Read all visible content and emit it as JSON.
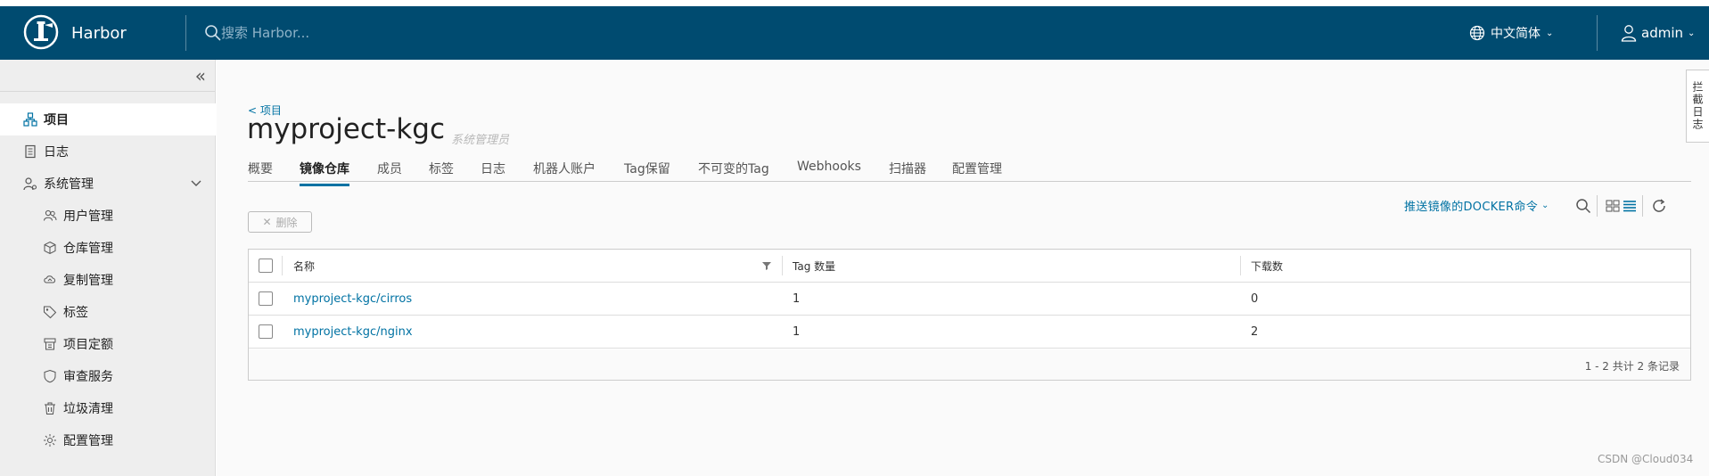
{
  "header": {
    "brand": "Harbor",
    "search_placeholder": "搜索 Harbor...",
    "language": "中文简体",
    "user": "admin"
  },
  "sidebar": {
    "items": [
      {
        "label": "项目",
        "icon": "projects-icon",
        "active": true
      },
      {
        "label": "日志",
        "icon": "logs-icon"
      },
      {
        "label": "系统管理",
        "icon": "admin-icon",
        "expanded": true
      }
    ],
    "sub_items": [
      {
        "label": "用户管理",
        "icon": "users-icon"
      },
      {
        "label": "仓库管理",
        "icon": "registries-icon"
      },
      {
        "label": "复制管理",
        "icon": "replication-icon"
      },
      {
        "label": "标签",
        "icon": "tag-icon"
      },
      {
        "label": "项目定额",
        "icon": "quota-icon"
      },
      {
        "label": "审查服务",
        "icon": "shield-icon"
      },
      {
        "label": "垃圾清理",
        "icon": "trash-icon"
      },
      {
        "label": "配置管理",
        "icon": "gear-icon"
      }
    ]
  },
  "project": {
    "back_link": "< 项目",
    "title": "myproject-kgc",
    "role": "系统管理员"
  },
  "tabs": [
    {
      "label": "概要"
    },
    {
      "label": "镜像仓库",
      "active": true
    },
    {
      "label": "成员"
    },
    {
      "label": "标签"
    },
    {
      "label": "日志"
    },
    {
      "label": "机器人账户"
    },
    {
      "label": "Tag保留"
    },
    {
      "label": "不可变的Tag"
    },
    {
      "label": "Webhooks"
    },
    {
      "label": "扫描器"
    },
    {
      "label": "配置管理"
    }
  ],
  "toolbar": {
    "delete_label": "删除",
    "push_command": "推送镜像的DOCKER命令"
  },
  "table": {
    "columns": [
      "名称",
      "Tag 数量",
      "下载数"
    ],
    "rows": [
      {
        "name": "myproject-kgc/cirros",
        "tags": "1",
        "pulls": "0"
      },
      {
        "name": "myproject-kgc/nginx",
        "tags": "1",
        "pulls": "2"
      }
    ],
    "footer": "1 - 2 共计 2 条记录"
  },
  "side_panel": "拦截日志",
  "watermark": "CSDN @Cloud034",
  "colors": {
    "header_bg": "#004b70",
    "link": "#0072a3"
  }
}
